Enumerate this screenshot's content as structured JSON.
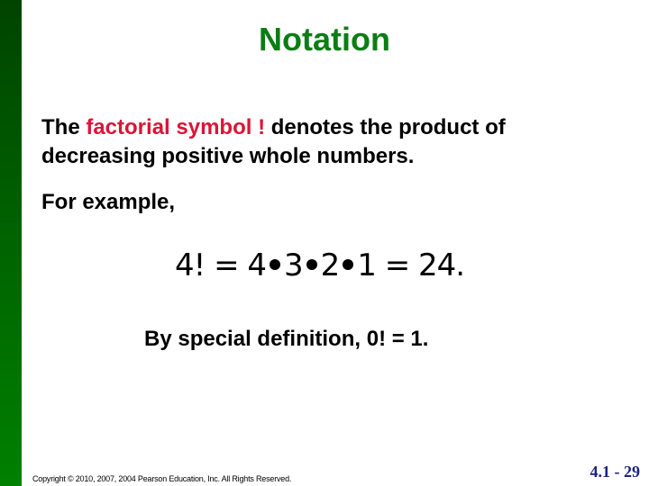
{
  "slide": {
    "title": "Notation",
    "accent_color": "#0a7d14",
    "highlight_color": "#dc1437",
    "definition": {
      "prefix": "The ",
      "highlight": "factorial symbol !",
      "suffix": " denotes the product of decreasing positive whole numbers."
    },
    "example_intro": "For example,",
    "equation": {
      "lhs": "4! = 4",
      "factors": [
        "3",
        "2",
        "1"
      ],
      "result": " = 24."
    },
    "special_definition": "By special definition, 0! = 1.",
    "footer": {
      "copyright": "Copyright © 2010, 2007, 2004 Pearson Education, Inc. All Rights Reserved.",
      "page_number": "4.1 - 29"
    }
  }
}
